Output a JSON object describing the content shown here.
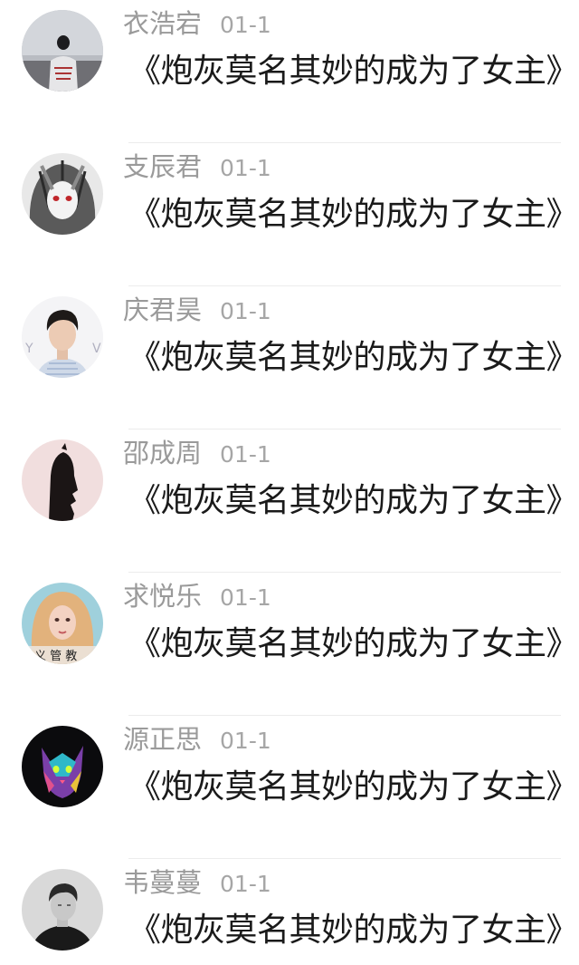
{
  "comments": [
    {
      "user": "衣浩宕",
      "date": "01-1",
      "text": "《炮灰莫名其妙的成为了女主》",
      "avatar_icon": "avatar-person-on-beach"
    },
    {
      "user": "支辰君",
      "date": "01-1",
      "text": "《炮灰莫名其妙的成为了女主》",
      "avatar_icon": "avatar-anime-girl-gray"
    },
    {
      "user": "庆君昊",
      "date": "01-1",
      "text": "《炮灰莫名其妙的成为了女主》",
      "avatar_icon": "avatar-young-man"
    },
    {
      "user": "邵成周",
      "date": "01-1",
      "text": "《炮灰莫名其妙的成为了女主》",
      "avatar_icon": "avatar-hooded-figure"
    },
    {
      "user": "求悦乐",
      "date": "01-1",
      "text": "《炮灰莫名其妙的成为了女主》",
      "avatar_icon": "avatar-blonde-woman"
    },
    {
      "user": "源正思",
      "date": "01-1",
      "text": "《炮灰莫名其妙的成为了女主》",
      "avatar_icon": "avatar-neon-cat"
    },
    {
      "user": "韦蔓蔓",
      "date": "01-1",
      "text": "《炮灰莫名其妙的成为了女主》",
      "avatar_icon": "avatar-man-dark"
    }
  ]
}
